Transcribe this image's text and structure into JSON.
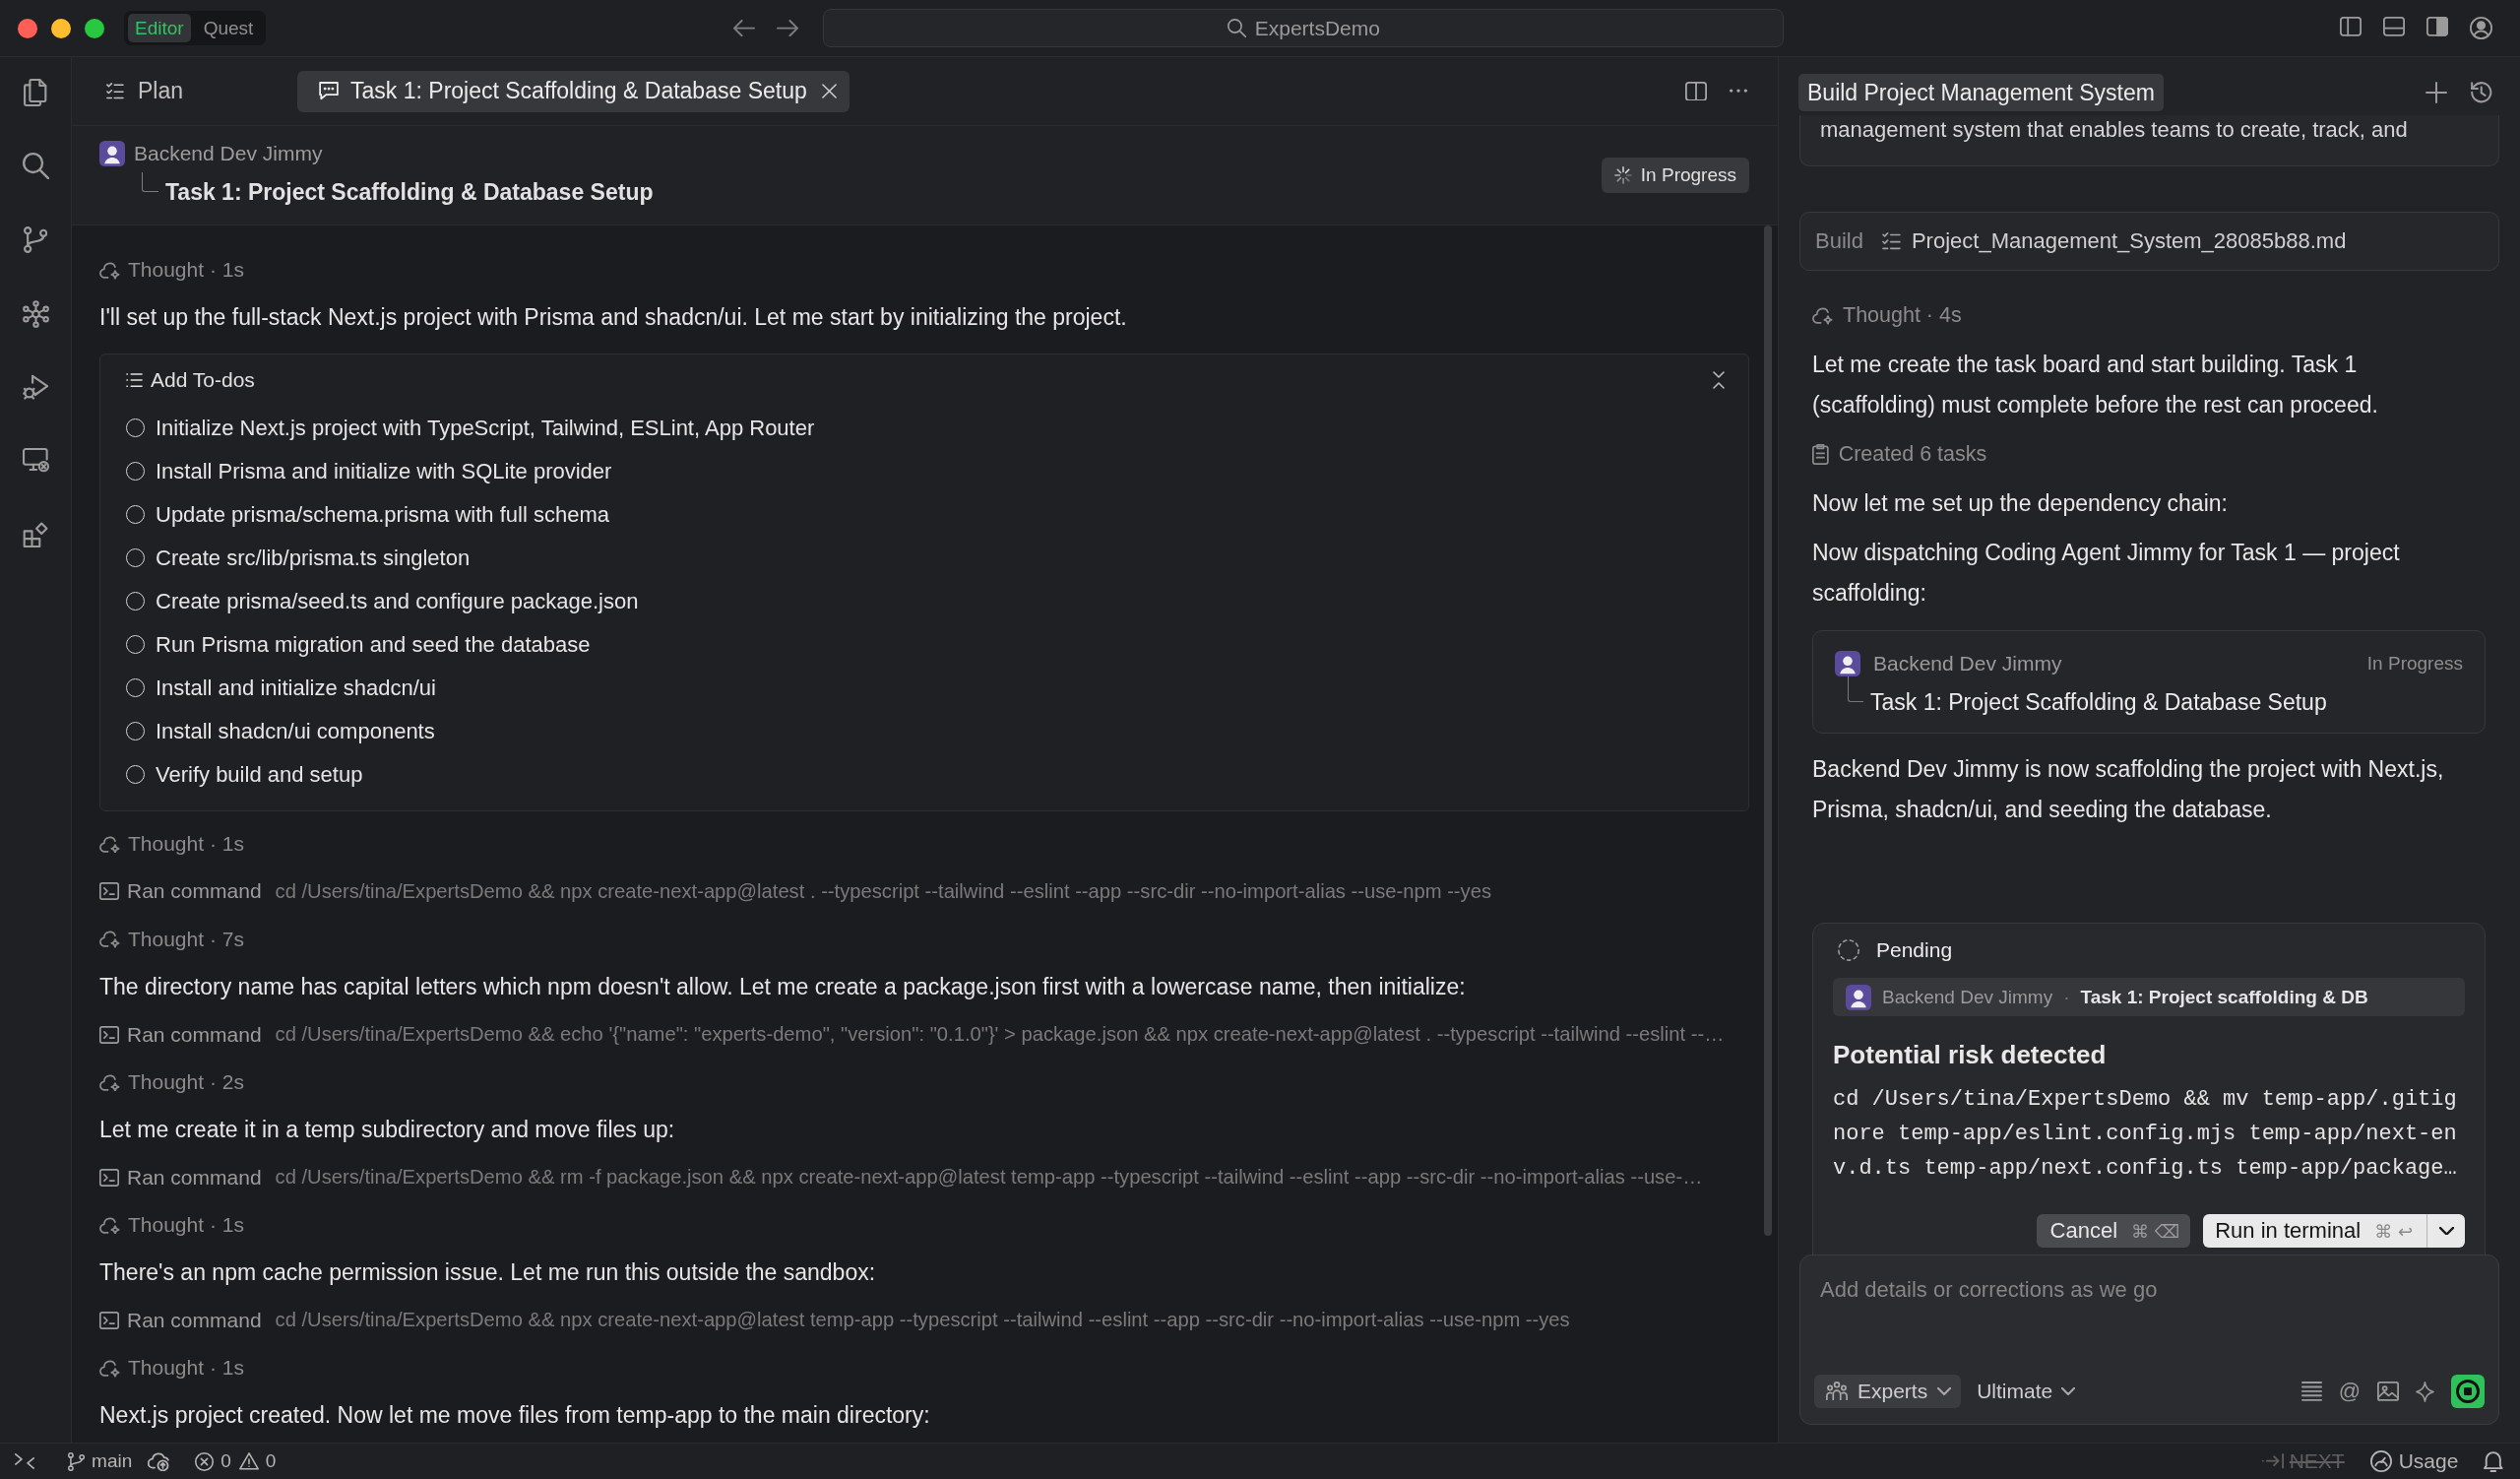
{
  "window": {
    "mode_tabs": [
      {
        "label": "Editor",
        "selected": true
      },
      {
        "label": "Quest",
        "selected": false
      }
    ],
    "command_center": "ExpertsDemo"
  },
  "editor": {
    "tabs": [
      {
        "kind": "plan",
        "label": "Plan",
        "selected": false
      },
      {
        "kind": "chat",
        "label": "Task 1: Project Scaffolding & Database Setup",
        "selected": true
      }
    ],
    "task_header": {
      "agent": "Backend Dev Jimmy",
      "task": "Task 1: Project Scaffolding & Database Setup",
      "status": "In Progress"
    },
    "feed": [
      {
        "kind": "thought",
        "label": "Thought · 1s"
      },
      {
        "kind": "message",
        "text": "I'll set up the full-stack Next.js project with Prisma and shadcn/ui. Let me start by initializing the project."
      },
      {
        "kind": "todos",
        "title": "Add To-dos",
        "expanded": true,
        "items": [
          {
            "text": "Initialize Next.js project with TypeScript, Tailwind, ESLint, App Router",
            "checked": false
          },
          {
            "text": "Install Prisma and initialize with SQLite provider",
            "checked": false
          },
          {
            "text": "Update prisma/schema.prisma with full schema",
            "checked": false
          },
          {
            "text": "Create src/lib/prisma.ts singleton",
            "checked": false
          },
          {
            "text": "Create prisma/seed.ts and configure package.json",
            "checked": false
          },
          {
            "text": "Run Prisma migration and seed the database",
            "checked": false
          },
          {
            "text": "Install and initialize shadcn/ui",
            "checked": false
          },
          {
            "text": "Install shadcn/ui components",
            "checked": false
          },
          {
            "text": "Verify build and setup",
            "checked": false
          }
        ]
      },
      {
        "kind": "thought",
        "label": "Thought · 1s"
      },
      {
        "kind": "command",
        "label": "Ran command",
        "command": "cd /Users/tina/ExpertsDemo && npx create-next-app@latest . --typescript --tailwind --eslint --app --src-dir --no-import-alias --use-npm --yes"
      },
      {
        "kind": "thought",
        "label": "Thought · 7s"
      },
      {
        "kind": "message",
        "text": "The directory name has capital letters which npm doesn't allow. Let me create a package.json first with a lowercase name, then initialize:"
      },
      {
        "kind": "command",
        "label": "Ran command",
        "command": "cd /Users/tina/ExpertsDemo && echo '{\"name\": \"experts-demo\", \"version\": \"0.1.0\"}' > package.json && npx create-next-app@latest . --typescript --tailwind --eslint --…"
      },
      {
        "kind": "thought",
        "label": "Thought · 2s"
      },
      {
        "kind": "message",
        "text": "Let me create it in a temp subdirectory and move files up:"
      },
      {
        "kind": "command",
        "label": "Ran command",
        "command": "cd /Users/tina/ExpertsDemo && rm -f package.json && npx create-next-app@latest temp-app --typescript --tailwind --eslint --app --src-dir --no-import-alias --use-…"
      },
      {
        "kind": "thought",
        "label": "Thought · 1s"
      },
      {
        "kind": "message",
        "text": "There's an npm cache permission issue. Let me run this outside the sandbox:"
      },
      {
        "kind": "command",
        "label": "Ran command",
        "command": "cd /Users/tina/ExpertsDemo && npx create-next-app@latest temp-app --typescript --tailwind --eslint --app --src-dir --no-import-alias --use-npm --yes"
      },
      {
        "kind": "thought",
        "label": "Thought · 1s"
      },
      {
        "kind": "message",
        "text": "Next.js project created. Now let me move files from temp-app to the main directory:"
      }
    ]
  },
  "chat": {
    "title": "Build Project Management System",
    "feed": [
      {
        "kind": "excerpt",
        "text": "management system that enables teams to create, track, and"
      },
      {
        "kind": "attachment",
        "label": "Build",
        "file": "Project_Management_System_28085b88.md"
      },
      {
        "kind": "thought",
        "label": "Thought · 4s"
      },
      {
        "kind": "message",
        "text": "Let me create the task board and start building. Task 1 (scaffolding) must complete before the rest can proceed."
      },
      {
        "kind": "activity",
        "label": "Created 6 tasks"
      },
      {
        "kind": "message",
        "text": "Now let me set up the dependency chain:"
      },
      {
        "kind": "message",
        "text": "Now dispatching Coding Agent Jimmy for Task 1 — project scaffolding:"
      },
      {
        "kind": "task_card",
        "agent": "Backend Dev Jimmy",
        "task": "Task 1: Project Scaffolding & Database Setup",
        "status": "In Progress"
      },
      {
        "kind": "message",
        "text": "Backend Dev Jimmy is now scaffolding the project with Next.js, Prisma, shadcn/ui, and seeding the database."
      }
    ]
  },
  "approval": {
    "status": "Pending",
    "agent": "Backend Dev Jimmy",
    "separator": "·",
    "task": "Task 1: Project scaffolding & DB",
    "title": "Potential risk detected",
    "command": "cd /Users/tina/ExpertsDemo && mv temp-app/.gitignore temp-app/eslint.config.mjs temp-app/next-env.d.ts temp-app/next.config.ts temp-app/package…",
    "actions": [
      {
        "kind": "secondary",
        "label": "Cancel",
        "shortcut": "⌘ ⌫"
      },
      {
        "kind": "primary",
        "label": "Run in terminal",
        "shortcut": "⌘ ↩"
      }
    ]
  },
  "composer": {
    "placeholder": "Add details or corrections as we go",
    "mode": "Experts",
    "model": "Ultimate",
    "mention": "@"
  },
  "status_bar": {
    "branch": "main",
    "errors": "0",
    "warnings": "0",
    "next": "NEXT",
    "usage": "Usage"
  }
}
